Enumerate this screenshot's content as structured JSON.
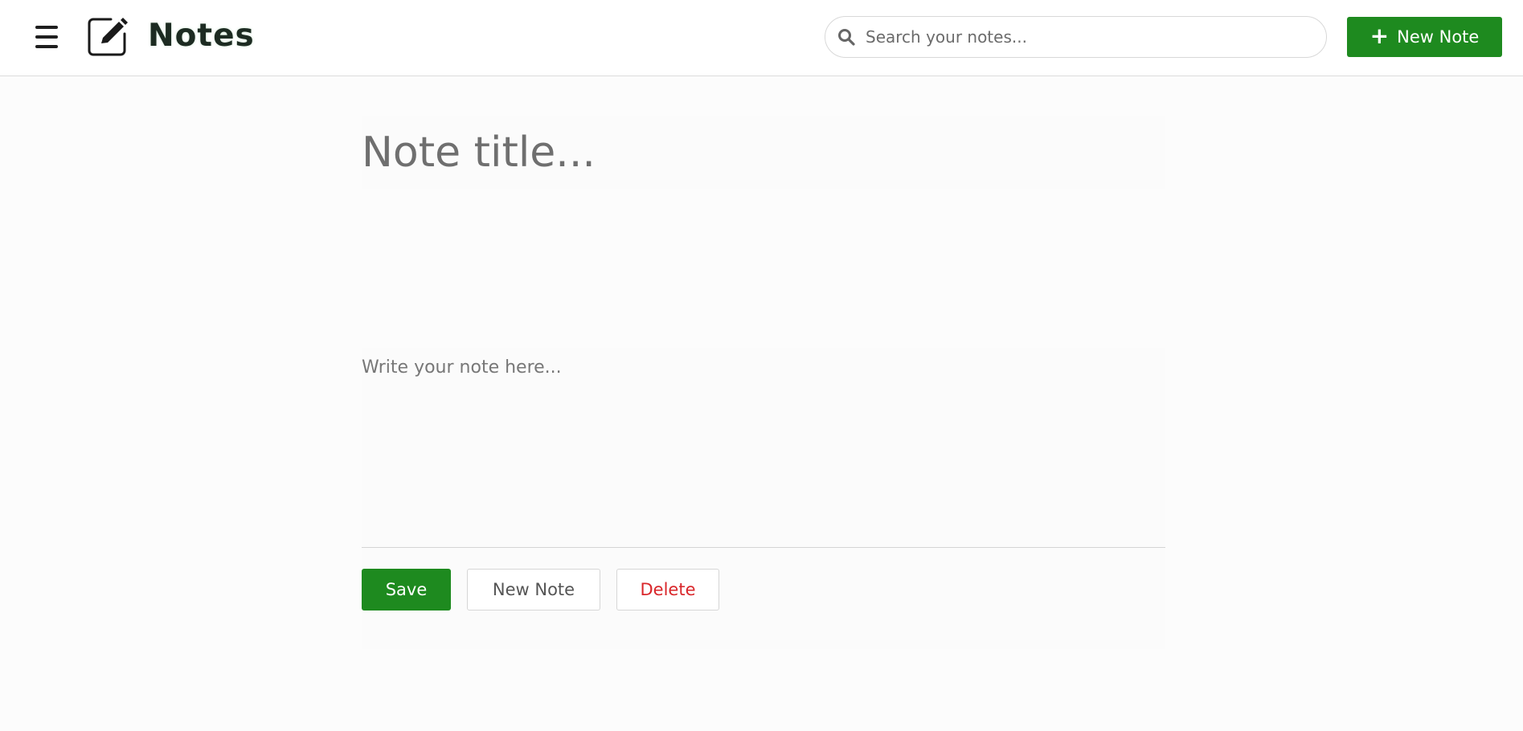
{
  "header": {
    "app_title": "Notes",
    "search_placeholder": "Search your notes...",
    "new_note_label": "New Note",
    "icons": {
      "menu": "hamburger-menu-icon",
      "logo": "edit-note-icon",
      "search": "search-icon",
      "plus": "plus-icon"
    }
  },
  "editor": {
    "title_placeholder": "Note title...",
    "title_value": "",
    "body_placeholder": "Write your note here...",
    "body_value": ""
  },
  "actions": {
    "save_label": "Save",
    "new_note_label": "New Note",
    "delete_label": "Delete"
  },
  "colors": {
    "primary_green": "#1e8a1f",
    "danger_red": "#d9262a",
    "page_background": "#fcfcfc"
  }
}
